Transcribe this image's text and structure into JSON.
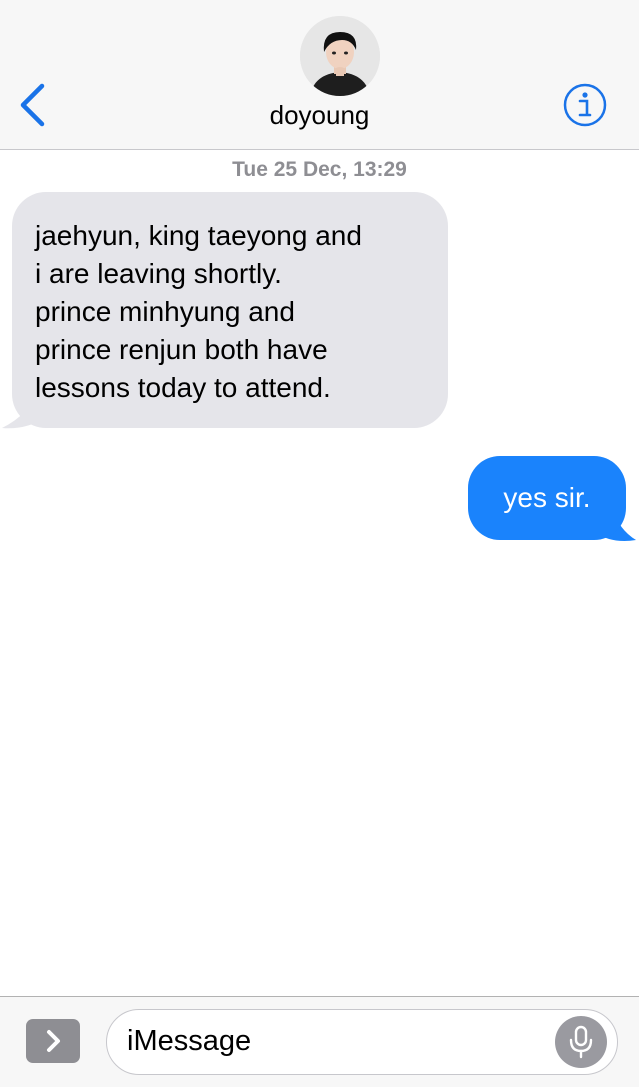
{
  "header": {
    "contact_name": "doyoung",
    "back_icon": "chevron-left-icon",
    "info_icon": "info-icon"
  },
  "conversation": {
    "timestamp": "Tue 25 Dec, 13:29",
    "messages": [
      {
        "direction": "incoming",
        "lines": [
          "jaehyun, king taeyong and",
          "i are leaving shortly.",
          "prince minhyung and",
          "prince renjun both have",
          "lessons today to attend."
        ]
      },
      {
        "direction": "outgoing",
        "lines": [
          "yes sir."
        ]
      }
    ]
  },
  "input": {
    "placeholder": "iMessage",
    "apps_icon": "chevron-right-icon",
    "mic_icon": "microphone-icon"
  },
  "colors": {
    "accent": "#1a83fc",
    "incoming_bubble": "#e5e5ea",
    "outgoing_bubble": "#1a83fc",
    "header_bg": "#f7f7f7",
    "timestamp": "#8e8e93"
  }
}
